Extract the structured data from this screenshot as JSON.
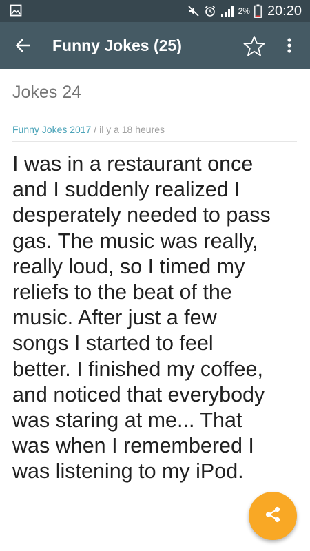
{
  "status_bar": {
    "battery_percent": "2%",
    "time": "20:20",
    "icons": [
      "gallery-icon",
      "mute-icon",
      "alarm-icon",
      "signal-icon",
      "battery-icon"
    ]
  },
  "app_bar": {
    "title": "Funny Jokes (25)",
    "icons": [
      "back-arrow-icon",
      "star-outline-icon",
      "more-vert-icon"
    ]
  },
  "joke": {
    "heading": "Jokes 24",
    "source": "Funny Jokes 2017",
    "separator": " / ",
    "time_ago": "il y a 18 heures",
    "lines": [
      "I was in a restaurant once",
      "and I suddenly realized I",
      "desperately needed to pass",
      "gas. The music was really,",
      "really loud, so I timed my",
      "reliefs to the beat of the",
      "music. After just a few",
      "songs I started to feel",
      "better. I finished my coffee,",
      "and noticed that everybody",
      "was staring at me... That",
      "was when I remembered I",
      "was listening to my iPod."
    ]
  },
  "fab": {
    "icon": "share-icon"
  },
  "colors": {
    "status_bar": "#37474f",
    "app_bar": "#455a64",
    "source_link": "#4aa3b8",
    "fab": "#f9a825"
  }
}
